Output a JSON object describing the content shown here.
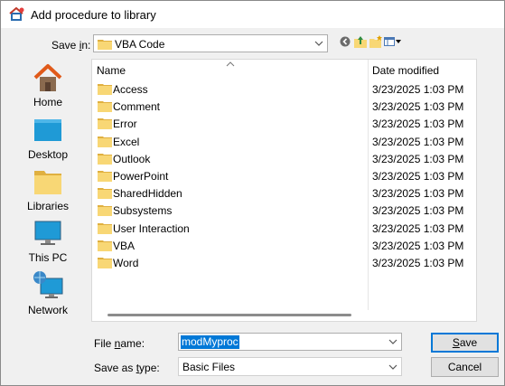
{
  "window": {
    "title": "Add procedure to library"
  },
  "save_in": {
    "label_pre": "Save ",
    "label_underline": "i",
    "label_post": "n:",
    "value": "VBA Code"
  },
  "places": [
    {
      "label": "Home",
      "icon": "home-icon"
    },
    {
      "label": "Desktop",
      "icon": "desktop-icon"
    },
    {
      "label": "Libraries",
      "icon": "libraries-icon"
    },
    {
      "label": "This PC",
      "icon": "this-pc-icon"
    },
    {
      "label": "Network",
      "icon": "network-icon"
    }
  ],
  "file_list": {
    "columns": {
      "name": "Name",
      "date": "Date modified"
    },
    "rows": [
      {
        "name": "Access",
        "date": "3/23/2025 1:03 PM"
      },
      {
        "name": "Comment",
        "date": "3/23/2025 1:03 PM"
      },
      {
        "name": "Error",
        "date": "3/23/2025 1:03 PM"
      },
      {
        "name": "Excel",
        "date": "3/23/2025 1:03 PM"
      },
      {
        "name": "Outlook",
        "date": "3/23/2025 1:03 PM"
      },
      {
        "name": "PowerPoint",
        "date": "3/23/2025 1:03 PM"
      },
      {
        "name": "SharedHidden",
        "date": "3/23/2025 1:03 PM"
      },
      {
        "name": "Subsystems",
        "date": "3/23/2025 1:03 PM"
      },
      {
        "name": "User Interaction",
        "date": "3/23/2025 1:03 PM"
      },
      {
        "name": "VBA",
        "date": "3/23/2025 1:03 PM"
      },
      {
        "name": "Word",
        "date": "3/23/2025 1:03 PM"
      }
    ]
  },
  "file_name": {
    "label_pre": "File ",
    "label_underline": "n",
    "label_post": "ame:",
    "value": "modMyproc"
  },
  "save_as_type": {
    "label_pre": "Save as ",
    "label_underline": "t",
    "label_post": "ype:",
    "value": "Basic Files"
  },
  "buttons": {
    "save_underline": "S",
    "save_rest": "ave",
    "cancel": "Cancel"
  },
  "colors": {
    "accent": "#0078d7",
    "folder": "#f8d775",
    "folder_dark": "#e0b040"
  }
}
